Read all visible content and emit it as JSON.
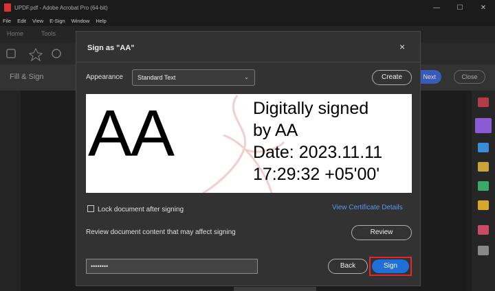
{
  "window": {
    "title": "UPDF.pdf - Adobe Acrobat Pro (64-bit)",
    "controls": [
      "—",
      "☐",
      "✕"
    ]
  },
  "menu": [
    "File",
    "Edit",
    "View",
    "E-Sign",
    "Window",
    "Help"
  ],
  "tabs": [
    "Home",
    "Tools"
  ],
  "fill_sign": {
    "title": "Fill & Sign",
    "next_label": "Next",
    "close_label": "Close"
  },
  "dialog": {
    "title": "Sign as \"AA\"",
    "close_icon": "×",
    "appearance_label": "Appearance",
    "appearance_value": "Standard Text",
    "create_label": "Create",
    "preview": {
      "name": "AA",
      "lines": [
        "Digitally signed",
        "by AA",
        "Date: 2023.11.11",
        "17:29:32 +05'00'"
      ]
    },
    "lock_label": "Lock document after signing",
    "view_cert_label": "View Certificate Details",
    "review_text": "Review document content that may affect signing",
    "review_label": "Review",
    "password_value": "••••••••",
    "back_label": "Back",
    "sign_label": "Sign"
  },
  "colors": {
    "accent": "#1f6fd6",
    "highlight": "#e5252a",
    "link": "#5a9ae6"
  }
}
